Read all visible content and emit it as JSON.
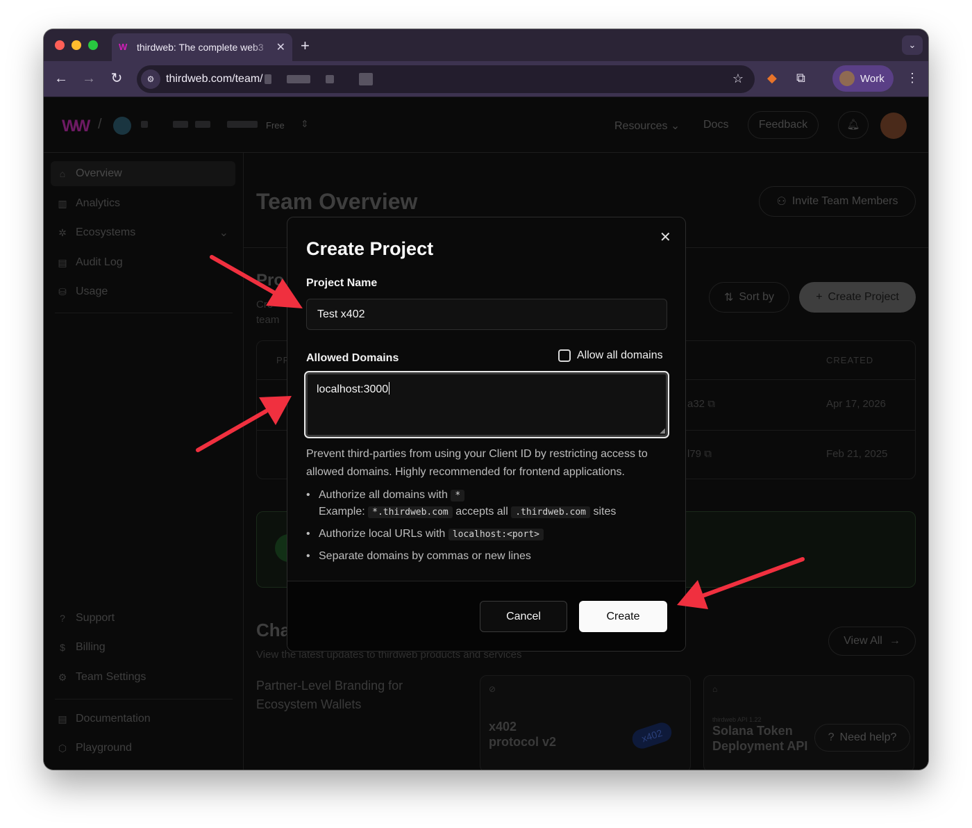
{
  "browser": {
    "tab_title": "thirdweb: The complete web3",
    "url": "thirdweb.com/team/",
    "profile_label": "Work"
  },
  "app": {
    "plan_badge": "Free",
    "nav": {
      "resources": "Resources",
      "docs": "Docs",
      "feedback": "Feedback"
    },
    "sidebar": {
      "items": [
        {
          "label": "Overview",
          "icon": "home-icon"
        },
        {
          "label": "Analytics",
          "icon": "bar-chart-icon"
        },
        {
          "label": "Ecosystems",
          "icon": "ecosystem-icon"
        },
        {
          "label": "Audit Log",
          "icon": "document-icon"
        },
        {
          "label": "Usage",
          "icon": "database-icon"
        }
      ],
      "bottom_items": [
        {
          "label": "Support",
          "icon": "help-circle-icon"
        },
        {
          "label": "Billing",
          "icon": "dollar-icon"
        },
        {
          "label": "Team Settings",
          "icon": "gear-icon"
        },
        {
          "label": "Documentation",
          "icon": "document-icon"
        },
        {
          "label": "Playground",
          "icon": "cube-icon"
        }
      ]
    },
    "page_title": "Team Overview",
    "invite_button": "Invite Team Members",
    "projects_heading": "Pro",
    "projects_sub_1": "Cre",
    "projects_sub_2": "team",
    "sort_button": "Sort by",
    "create_project_button": "Create Project",
    "table": {
      "header_first": "PR",
      "header_created": "CREATED",
      "rows": [
        {
          "client_suffix": "a32",
          "created": "Apr 17, 2026"
        },
        {
          "client_suffix": "l79",
          "created": "Feb 21, 2025"
        }
      ]
    },
    "changelog_heading": "Cha",
    "changelog_sub": "View the latest updates to thirdweb products and services",
    "view_all": "View All",
    "cards": [
      {
        "title": "Partner-Level Branding for Ecosystem Wallets"
      },
      {
        "title": "x402 protocol v2",
        "badge": "x402"
      },
      {
        "title": "Solana Token Deployment API",
        "eyebrow": "thirdweb API 1.22"
      }
    ],
    "need_help": "Need help?"
  },
  "modal": {
    "title": "Create Project",
    "project_name_label": "Project Name",
    "project_name_value": "Test x402",
    "allowed_domains_label": "Allowed Domains",
    "allow_all_label": "Allow all domains",
    "allow_all_checked": false,
    "domains_value": "localhost:3000",
    "help_text": "Prevent third-parties from using your Client ID by restricting access to allowed domains. Highly recommended for frontend applications.",
    "bullets": {
      "b1_text": "Authorize all domains with",
      "b1_code": "*",
      "b1_example": "Example:",
      "b1_code2": "*.thirdweb.com",
      "b1_mid": "accepts all",
      "b1_code3": ".thirdweb.com",
      "b1_end": "sites",
      "b2_text": "Authorize local URLs with",
      "b2_code": "localhost:<port>",
      "b3_text": "Separate domains by commas or new lines"
    },
    "cancel_button": "Cancel",
    "create_button": "Create"
  },
  "colors": {
    "arrow": "#f0303f",
    "brand": "#d21fb8",
    "profile": "#5a3f86"
  }
}
